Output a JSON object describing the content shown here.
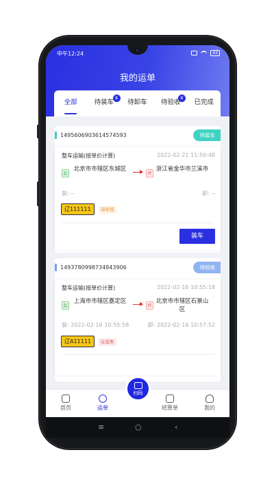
{
  "status_bar": {
    "time": "中午12:24",
    "battery": "43"
  },
  "page_title": "我的运单",
  "tabs": [
    {
      "label": "全部",
      "active": true
    },
    {
      "label": "待装车",
      "badge": "8"
    },
    {
      "label": "待卸车"
    },
    {
      "label": "待验收",
      "badge": "8"
    },
    {
      "label": "已完成"
    }
  ],
  "orders": [
    {
      "order_no": "1495606903614574593",
      "status": "待装车",
      "status_color": "#40d3c3",
      "pricing": "整车运输(按单价计算)",
      "created": "2022-02-21 11:50:48",
      "start_tag": "起",
      "from": "北京市市辖区东城区",
      "end_tag": "终",
      "to": "浙江省金华市兰溪市",
      "load_time": "装: --",
      "unload_time": "卸: --",
      "plate": "辽111111",
      "review_status": "待审核",
      "review_color": "#e89a3c",
      "action": "装车"
    },
    {
      "order_no": "1493780998734843906",
      "status": "待验收",
      "status_color": "#8fb4f0",
      "pricing": "整车运输(按单价计算)",
      "created": "2022-02-16 10:55:18",
      "start_tag": "起",
      "from": "上海市市辖区嘉定区",
      "end_tag": "终",
      "to": "北京市市辖区石景山区",
      "load_time": "装: 2022-02-16 10:55:58",
      "unload_time": "卸: 2022-02-16 10:57:52",
      "plate": "辽A11111",
      "review_status": "认证失",
      "review_color": "#e05252"
    }
  ],
  "tabbar": {
    "home": "首页",
    "waybill": "运单",
    "scan": "扫码",
    "settlement": "结算单",
    "mine": "我的"
  },
  "nav": {
    "menu": "≡",
    "home": "○",
    "back": "‹"
  }
}
